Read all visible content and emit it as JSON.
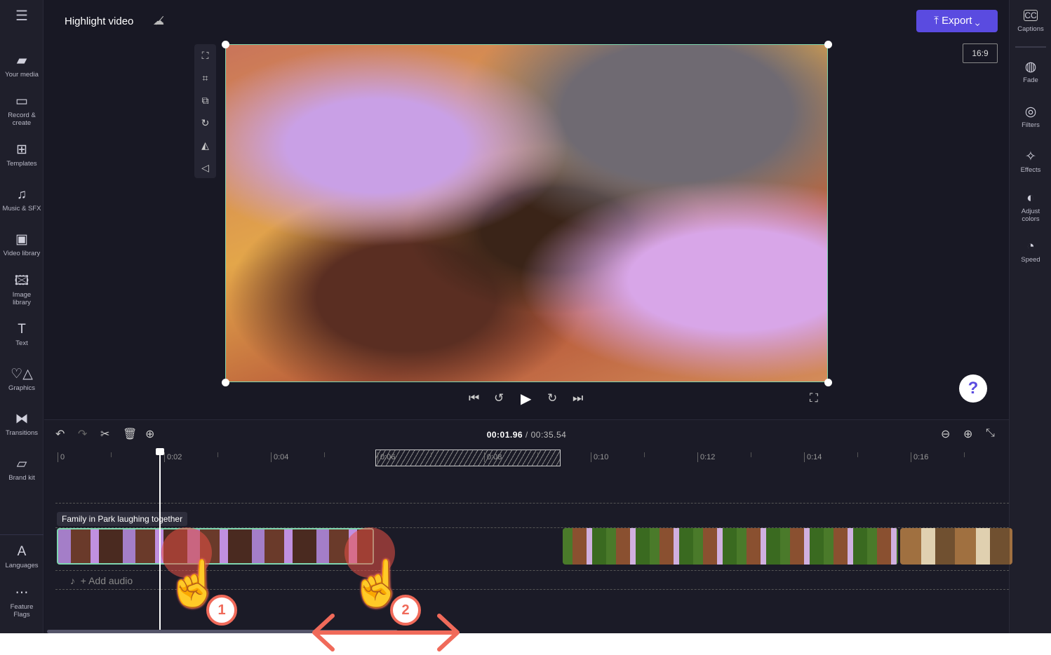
{
  "header": {
    "title": "Highlight video",
    "cloud_icon": "cloud-off-icon",
    "export_label": "Export",
    "aspect_ratio": "16:9"
  },
  "left_nav": [
    {
      "label": "Your media",
      "icon": "folder-icon"
    },
    {
      "label": "Record & create",
      "icon": "camera-icon"
    },
    {
      "label": "Templates",
      "icon": "templates-icon"
    },
    {
      "label": "Music & SFX",
      "icon": "music-icon"
    },
    {
      "label": "Video library",
      "icon": "film-icon"
    },
    {
      "label": "Image library",
      "icon": "image-icon"
    },
    {
      "label": "Text",
      "icon": "text-icon"
    },
    {
      "label": "Graphics",
      "icon": "shapes-icon"
    },
    {
      "label": "Transitions",
      "icon": "transition-icon"
    },
    {
      "label": "Brand kit",
      "icon": "brand-icon"
    },
    {
      "label": "Languages",
      "icon": "language-icon"
    },
    {
      "label": "Feature Flags",
      "icon": "more-icon"
    }
  ],
  "right_nav": [
    {
      "label": "Captions",
      "icon": "cc-icon"
    },
    {
      "label": "Fade",
      "icon": "fade-icon"
    },
    {
      "label": "Filters",
      "icon": "filters-icon"
    },
    {
      "label": "Effects",
      "icon": "wand-icon"
    },
    {
      "label": "Adjust colors",
      "icon": "contrast-icon"
    },
    {
      "label": "Speed",
      "icon": "gauge-icon"
    }
  ],
  "timeline": {
    "current": "00:01.96",
    "separator": "/",
    "total": "00:35.54",
    "ticks": [
      "0",
      "0:02",
      "0:04",
      "0:06",
      "0:08",
      "0:10",
      "0:12",
      "0:14",
      "0:16"
    ],
    "clip_label": "Family in Park laughing together",
    "add_audio": "+ Add audio"
  },
  "annotations": {
    "step1": "1",
    "step2": "2",
    "accent": "#f06a5a"
  },
  "colors": {
    "export": "#5a4be0",
    "selection": "#7fd6b0"
  }
}
